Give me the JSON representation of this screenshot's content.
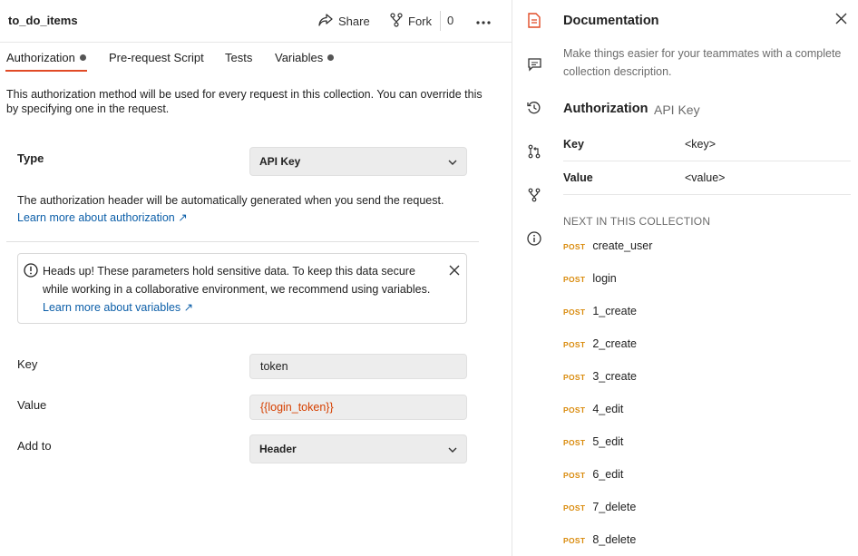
{
  "collection": {
    "title": "to_do_items",
    "share_label": "Share",
    "fork_label": "Fork",
    "fork_count": "0"
  },
  "tabs": [
    {
      "label": "Authorization",
      "active": true,
      "indicator": true
    },
    {
      "label": "Pre-request Script",
      "active": false,
      "indicator": false
    },
    {
      "label": "Tests",
      "active": false,
      "indicator": false
    },
    {
      "label": "Variables",
      "active": false,
      "indicator": true
    }
  ],
  "auth": {
    "description": "This authorization method will be used for every request in this collection. You can override this by specifying one in the request.",
    "type_label": "Type",
    "type_value": "API Key",
    "header_info": "The authorization header will be automatically generated when you send the request.",
    "learn_more": "Learn more about authorization ↗",
    "alert": {
      "text": "Heads up! These parameters hold sensitive data. To keep this data secure while working in a collaborative environment, we recommend using variables.",
      "link": "Learn more about variables ↗"
    },
    "key_label": "Key",
    "key_value": "token",
    "value_label": "Value",
    "value_value": "{{login_token}}",
    "addto_label": "Add to",
    "addto_value": "Header"
  },
  "documentation": {
    "title": "Documentation",
    "description": "Make things easier for your teammates with a complete collection description.",
    "auth_heading": "Authorization",
    "auth_type": "API Key",
    "rows": [
      {
        "key": "Key",
        "value": "<key>"
      },
      {
        "key": "Value",
        "value": "<value>"
      }
    ],
    "next_heading": "NEXT IN THIS COLLECTION",
    "requests": [
      {
        "method": "POST",
        "name": "create_user"
      },
      {
        "method": "POST",
        "name": "login"
      },
      {
        "method": "POST",
        "name": "1_create"
      },
      {
        "method": "POST",
        "name": "2_create"
      },
      {
        "method": "POST",
        "name": "3_create"
      },
      {
        "method": "POST",
        "name": "4_edit"
      },
      {
        "method": "POST",
        "name": "5_edit"
      },
      {
        "method": "POST",
        "name": "6_edit"
      },
      {
        "method": "POST",
        "name": "7_delete"
      },
      {
        "method": "POST",
        "name": "8_delete"
      }
    ]
  },
  "colors": {
    "accent": "#e14b26",
    "link": "#0b5ea8",
    "variable": "#d64000",
    "post_method": "#d98a0b"
  },
  "icons": {
    "sidebar": [
      "documentation-icon",
      "comments-icon",
      "history-icon",
      "pull-request-icon",
      "fork-icon",
      "info-icon"
    ]
  }
}
